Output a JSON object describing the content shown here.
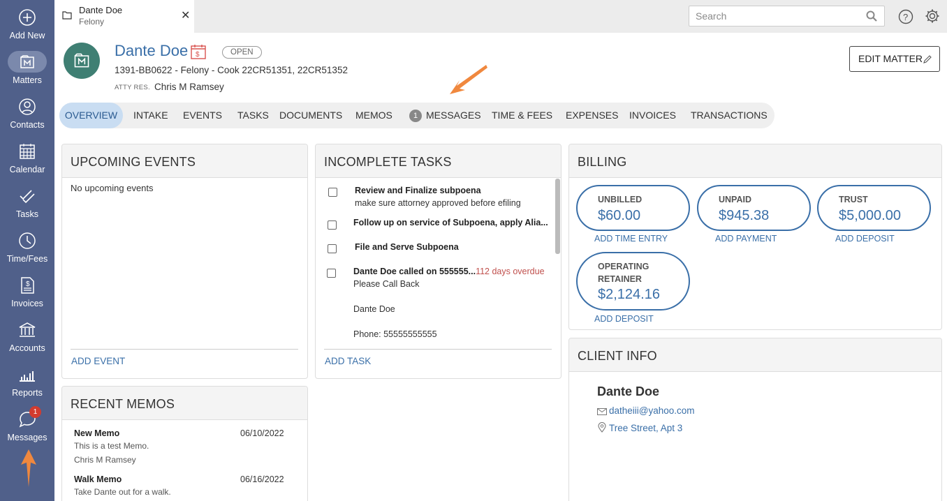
{
  "sidebar": {
    "items": [
      {
        "label": "Add New",
        "icon": "plus-circle-icon"
      },
      {
        "label": "Matters",
        "icon": "matters-icon"
      },
      {
        "label": "Contacts",
        "icon": "contacts-icon"
      },
      {
        "label": "Calendar",
        "icon": "calendar-icon"
      },
      {
        "label": "Tasks",
        "icon": "tasks-icon"
      },
      {
        "label": "Time/Fees",
        "icon": "clock-icon"
      },
      {
        "label": "Invoices",
        "icon": "invoice-icon"
      },
      {
        "label": "Accounts",
        "icon": "bank-icon"
      },
      {
        "label": "Reports",
        "icon": "bar-chart-icon"
      },
      {
        "label": "Messages",
        "icon": "chat-icon"
      }
    ],
    "messages_badge": "1",
    "active": "Matters"
  },
  "topbar": {
    "tab": {
      "title": "Dante Doe",
      "subtitle": "Felony",
      "close": "✕"
    },
    "search_placeholder": "Search"
  },
  "matter": {
    "client_name": "Dante Doe",
    "status": "OPEN",
    "line": "1391-BB0622 - Felony - Cook 22CR51351, 22CR51352",
    "atty_label": "ATTY RES.",
    "atty_name": "Chris M Ramsey",
    "edit_label": "EDIT MATTER"
  },
  "tabs": [
    "OVERVIEW",
    "INTAKE",
    "EVENTS",
    "TASKS",
    "DOCUMENTS",
    "MEMOS",
    "MESSAGES",
    "TIME & FEES",
    "EXPENSES",
    "INVOICES",
    "TRANSACTIONS"
  ],
  "messages_count": "1",
  "upcoming_events": {
    "title": "UPCOMING EVENTS",
    "empty": "No upcoming events",
    "add": "ADD EVENT"
  },
  "incomplete_tasks": {
    "title": "INCOMPLETE TASKS",
    "tasks": [
      {
        "title": "Review and Finalize subpoena",
        "sub": "make sure attorney approved before efiling"
      },
      {
        "title": "Follow up on service of Subpoena, apply Alia..."
      },
      {
        "title": "File and Serve Subpoena"
      },
      {
        "title": "Dante Doe called on 555555...",
        "overdue": "112 days overdue",
        "lines": [
          "Please Call Back",
          "Dante Doe",
          "Phone: 55555555555"
        ]
      }
    ],
    "add": "ADD TASK"
  },
  "billing": {
    "title": "BILLING",
    "unbilled": {
      "label": "UNBILLED",
      "value": "$60.00",
      "action": "ADD TIME ENTRY"
    },
    "unpaid": {
      "label": "UNPAID",
      "value": "$945.38",
      "action": "ADD PAYMENT"
    },
    "trust": {
      "label": "TRUST",
      "value": "$5,000.00",
      "action": "ADD DEPOSIT"
    },
    "operating": {
      "label1": "OPERATING",
      "label2": "RETAINER",
      "value": "$2,124.16",
      "action": "ADD DEPOSIT"
    }
  },
  "client_info": {
    "title": "CLIENT INFO",
    "name": "Dante Doe",
    "email": "datheiii@yahoo.com",
    "address": "Tree Street, Apt 3"
  },
  "recent_memos": {
    "title": "RECENT MEMOS",
    "memos": [
      {
        "title": "New Memo",
        "date": "06/10/2022",
        "text": "This is a test Memo.",
        "author": "Chris M Ramsey"
      },
      {
        "title": "Walk Memo",
        "date": "06/16/2022",
        "text": "Take Dante out for a walk."
      }
    ]
  },
  "colors": {
    "sidebar": "#50608a",
    "accent": "#3a6fa8",
    "annotation_arrow": "#f0883e",
    "overdue": "#c0504d"
  }
}
